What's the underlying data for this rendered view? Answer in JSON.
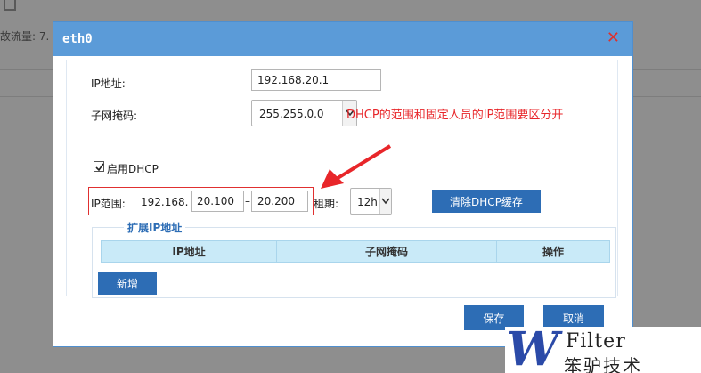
{
  "background": {
    "text": "故流量: 7."
  },
  "dialog": {
    "title": "eth0",
    "close_label": "✕",
    "fields": {
      "ip_label": "IP地址:",
      "ip_value": "192.168.20.1",
      "mask_label": "子网掩码:",
      "mask_value": "255.255.0.0",
      "dhcp_label": "启用DHCP",
      "dhcp_checked": true,
      "range_label": "IP范围:",
      "range_prefix": "192.168.",
      "range_start": "20.100",
      "range_sep": "–",
      "range_end": "20.200",
      "lease_label": "租期:",
      "lease_value": "12h",
      "clear_cache_label": "清除DHCP缓存"
    },
    "annotation": "DHCP的范围和固定人员的IP范围要区分开",
    "extended": {
      "legend": "扩展IP地址",
      "columns": [
        "IP地址",
        "子网掩码",
        "操作"
      ],
      "add_label": "新增"
    },
    "save_label": "保存",
    "cancel_label": "取消"
  },
  "watermark": {
    "letter": "W",
    "name": "Filter",
    "cn": "笨驴技术"
  },
  "colors": {
    "header": "#5b9bd8",
    "primary_button": "#2d6db5",
    "annotation": "#e8262a",
    "table_header": "#c9eaf8"
  }
}
